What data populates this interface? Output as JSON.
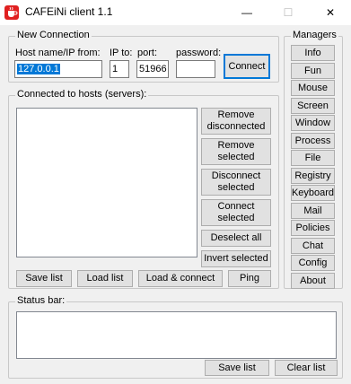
{
  "window": {
    "title": "CAFEiNi client 1.1",
    "icon": "coffee-app-icon",
    "minimize": "—",
    "maximize": "☐",
    "close": "✕"
  },
  "new_connection": {
    "legend": "New Connection",
    "host_label": "Host name/IP from:",
    "host_value": "127.0.0.1",
    "ipto_label": "IP to:",
    "ipto_value": "1",
    "port_label": "port:",
    "port_value": "51966",
    "password_label": "password:",
    "password_value": "",
    "connect_label": "Connect"
  },
  "hosts": {
    "legend": "Connected to hosts (servers):",
    "remove_disconnected": "Remove disconnected",
    "remove_selected": "Remove selected",
    "disconnect_selected": "Disconnect selected",
    "connect_selected": "Connect selected",
    "deselect_all": "Deselect all",
    "invert_selected": "Invert selected",
    "save_list": "Save list",
    "load_list": "Load list",
    "load_connect": "Load & connect",
    "ping": "Ping"
  },
  "managers": {
    "legend": "Managers",
    "items": [
      "Info",
      "Fun",
      "Mouse",
      "Screen",
      "Window",
      "Process",
      "File",
      "Registry",
      "Keyboard",
      "Mail",
      "Policies",
      "Chat",
      "Config",
      "About"
    ]
  },
  "status": {
    "legend": "Status bar:",
    "text": "",
    "save_list": "Save list",
    "clear_list": "Clear list"
  }
}
